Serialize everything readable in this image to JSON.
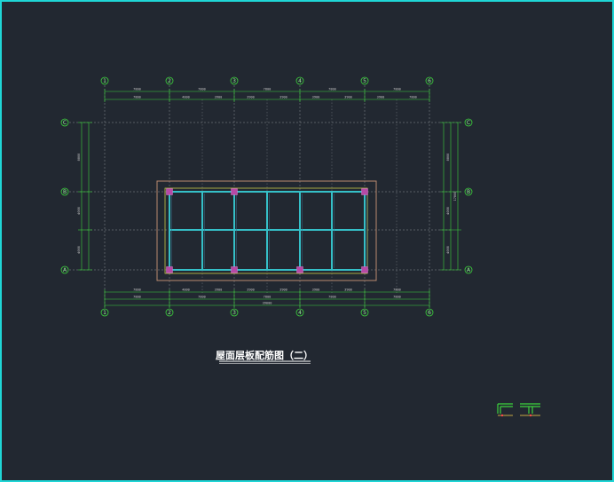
{
  "drawing": {
    "title": "屋面层板配筋图（二）",
    "colors": {
      "background": "#222831",
      "frame": "#1fd6d6",
      "grid": "#8a8f96",
      "dimension": "#3dd33d",
      "beam": "#35c0c8",
      "column": "#b64aa6",
      "outline": "#b98a6e",
      "inner_outline": "#c7c84a"
    },
    "column_axes": [
      "1",
      "2",
      "3",
      "4",
      "5",
      "6"
    ],
    "row_axes": [
      "C",
      "B",
      "A"
    ],
    "top_dims_row1": [
      "7800",
      "7800",
      "7800",
      "7800",
      "7800"
    ],
    "top_dims_row2": [
      "7800",
      "4000",
      "3900",
      "3900",
      "3900",
      "3900",
      "3900",
      "3900",
      "7800"
    ],
    "bottom_dims_row1": [
      "7800",
      "4000",
      "3900",
      "3900",
      "3900",
      "3900",
      "3900",
      "7800"
    ],
    "bottom_dims_row2": [
      "7800",
      "7800",
      "7800",
      "7800",
      "7800"
    ],
    "bottom_total": "39000",
    "left_dims": [
      "8800",
      "4000",
      "4000"
    ],
    "right_dims": [
      "8800",
      "4000",
      "4000"
    ],
    "right_total": "17800"
  }
}
